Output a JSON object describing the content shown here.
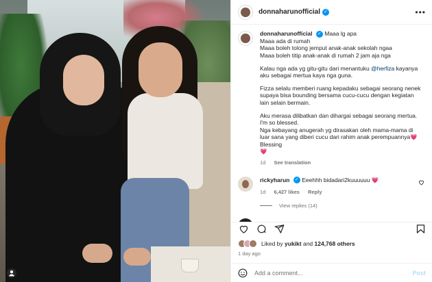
{
  "post": {
    "username": "donnaharunofficial",
    "verified_mark": "✓",
    "more_icon": "more-horizontal-icon",
    "photo_user_tag_icon": "person-tag-icon"
  },
  "caption": {
    "username": "donnaharunofficial",
    "verified_mark": "✓",
    "first_line": "Maaa lg apa",
    "lines": [
      "Maaa ada di rumah",
      "Maaa boleh tolong jemput anak-anak sekolah ngaa",
      "Maaa boleh titip anak-anak di rumah 2 jam aja nga"
    ],
    "para2_before": "Kalau nga ada yg gitu-gitu dari menantuku ",
    "para2_mention": "@herfiza",
    "para2_after": " kayanya aku sebagai mertua kaya nga guna.",
    "para3": "Fizza selalu memberi ruang kepadaku sebagai seorang nenek supaya bisa bounding bersama cucu-cucu dengan kegiatan lain selain bermain.",
    "para4_line1": "Aku merasa dilibatkan dan dihargai sebagai seorang mertua.",
    "para4_line2": "I'm so blessed.",
    "para4_line3": "Nga kebayang anugerah yg dirasakan oleh mama-mama di luar sana yang diberi cucu dari rahim anak perempuannya",
    "para4_heart": "💗",
    "para4_end": "Blessing",
    "para4_heart2": "💗",
    "time": "1d",
    "see_translation": "See translation"
  },
  "comment": {
    "username": "rickyharun",
    "verified_mark": "✓",
    "text": "Eeehhh bidadari2kuuuuuu",
    "heart": "💗",
    "time": "1d",
    "likes": "6,427 likes",
    "reply": "Reply",
    "view_replies": "View replies (14)",
    "like_icon": "heart-outline-icon"
  },
  "actions": {
    "like_icon": "heart-outline-icon",
    "comment_icon": "comment-icon",
    "share_icon": "share-icon",
    "save_icon": "bookmark-icon"
  },
  "likes": {
    "prefix": "Liked by ",
    "user": "yukikt",
    "middle": " and ",
    "count": "124,768 others"
  },
  "posted": "1 day ago",
  "add_comment": {
    "placeholder": "Add a comment...",
    "post_label": "Post",
    "emoji_icon": "emoji-icon"
  },
  "colors": {
    "link": "#00376b",
    "secondary": "#737373",
    "verified": "#0095f6",
    "post_disabled": "#b2dffc"
  }
}
